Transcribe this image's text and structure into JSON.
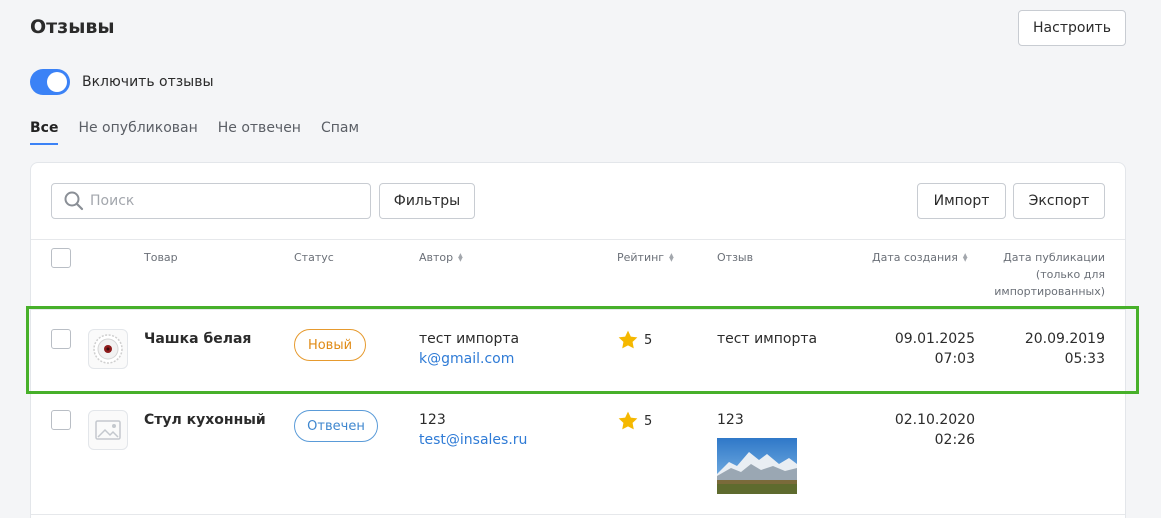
{
  "header": {
    "title": "Отзывы",
    "settings_label": "Настроить"
  },
  "toggle": {
    "label": "Включить отзывы",
    "enabled": true
  },
  "tabs": [
    {
      "label": "Все",
      "active": true
    },
    {
      "label": "Не опубликован",
      "active": false
    },
    {
      "label": "Не отвечен",
      "active": false
    },
    {
      "label": "Спам",
      "active": false
    }
  ],
  "toolbar": {
    "search_placeholder": "Поиск",
    "filters_label": "Фильтры",
    "import_label": "Импорт",
    "export_label": "Экспорт"
  },
  "columns": {
    "product": "Товар",
    "status": "Статус",
    "author": "Автор",
    "rating": "Рейтинг",
    "review": "Отзыв",
    "created": "Дата создания",
    "published_line1": "Дата публикации",
    "published_line2": "(только для",
    "published_line3": "импортированных)"
  },
  "rows": [
    {
      "product": "Чашка белая",
      "status": "Новый",
      "author_name": "тест импорта",
      "author_email": "k@gmail.com",
      "rating": "5",
      "review_text": "тест импорта",
      "created_date": "09.01.2025",
      "created_time": "07:03",
      "published_date": "20.09.2019",
      "published_time": "05:33"
    },
    {
      "product": "Стул кухонный",
      "status": "Отвечен",
      "author_name": "123",
      "author_email": "test@insales.ru",
      "rating": "5",
      "review_text": "123",
      "created_date": "02.10.2020",
      "created_time": "02:26"
    }
  ],
  "colors": {
    "accent": "#3b82f6",
    "badge_new": "#e08b16",
    "badge_answered": "#3f87cf",
    "star": "#f5b800",
    "highlight": "#47b02a"
  }
}
